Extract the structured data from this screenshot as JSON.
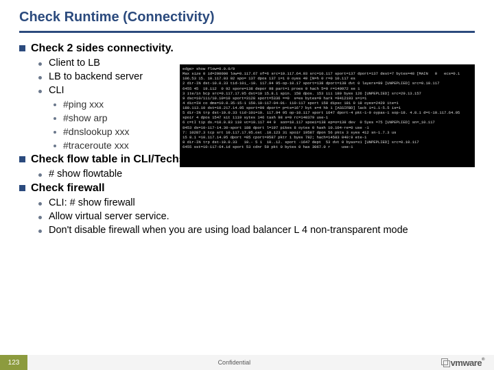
{
  "title": "Check Runtime (Connectivity)",
  "section1": {
    "heading": "Check 2 sides connectivity.",
    "items": {
      "a": "Client to LB",
      "b": "LB to backend server",
      "c": "CLI"
    },
    "cli": {
      "ping": "#ping xxx",
      "arp": "#show arp",
      "dns": "#dnslookup xxx",
      "trace": "#traceroute xxx"
    }
  },
  "section2": {
    "heading": "Check flow table in CLI/Techsupport Log",
    "items": {
      "a": "# show flowtable"
    }
  },
  "section3": {
    "heading": "Check firewall",
    "items": {
      "a": "CLI: # show firewall",
      "b": "Allow virtual server service.",
      "c": "Don't disable firewall when you are using load balancer L 4 non-transparent mode"
    }
  },
  "terminal_text": "edge> show flow=0.0.0/0\nMax size 0 id=200000 low=0.117.67 of=6 src=10.117.64.93 src=10.117 sport=137 dport=137 dest=7 bytes=48 [MAIN   0   ecs=0.1\n106.53 15. 10.117.03 92 spo= 137 dpos 137 i=1 0 oyes 49 [N=h 0 r=0 10.117 es\n2 dir-IN dst-10.0.33 tid-10i_-10. 117.94 95-op-10.17 sport=138 dport=138 dvt 0 layers=99 [UNPEPLIED] src=0.10.117\n6455 45  19.112  0 92 spore=138 depor 98 part=1 proes 9 hach 5=0 r=140972 se 1\n3 ite/in bcp src=0.117.17.95 dst=10 15.8.1 spin. 158 dpos. 153 iii 180 byes 126 [UNPEPLIED] src=29.13.157\n9 dsc=10/111/10.10=10 sport=3128 sport=5336 ==0  s=es bytes=9 hark =9412193 s=i=1\n4 dic=IH co dms=10.0.35-15-1 150.10-117-04-01- 110-117 sport 158 dipsc 181 0 18 oyes=2429 ite=1\n180.113.10 dst=10.217.14.95 sport=99 dport= p=ts=16'7 byt s=4 hb 1 [ASSIFBD] lack i=1.1-5.5 is=1\n5 dir-IN trp dst-10.0.33 tid-10i=10. 117.94 95 op-10.117 sport 1647 dport-4 pkt-1-9 oypas-1 sop-18. 4.8.1 d=t-10.117.64.95\nspoir 4 dpos 1547 sit 1119 sytes 146 tash 98 s=0 rc=140379 use-1\n6 c=tI tip ds.=10.0.83 110 vc=10.117 44 9  son=10.117 spoei=138 ep=o=138 dev  0 5yes =75 [UNPEPLIED] sn=_10.117\n8453 ds=10-117-14.30-sport 188 dport l=197 pikes 8 oytes 0 hash 10.104-re=0 use -1\n7: 10287.3 tcp srt 10.117.17.95.ost .10.123 31 spoir 19587 dpon 56 pkts 3 syes 412 sn-1.7.3 us\n15 8.1 =10.117.14.95 dport =85 cport=9587 pktr 1 byes 782; hach=14583 040:9 ete-1\n8 dir-IN trp dst-10.0.33   10.- 5 1  10..12. sport -1647 dept  53 dvt 0 byas=x1 [UNPEPLIED] src=0.10.117\n6455 sst=10-117-64.id sport 53 cdnr 59 pkt 0 bytes 0 has 3067.0 r     use-1",
  "footer": {
    "page": "123",
    "confidential": "Confidential",
    "brand": "vmware"
  }
}
